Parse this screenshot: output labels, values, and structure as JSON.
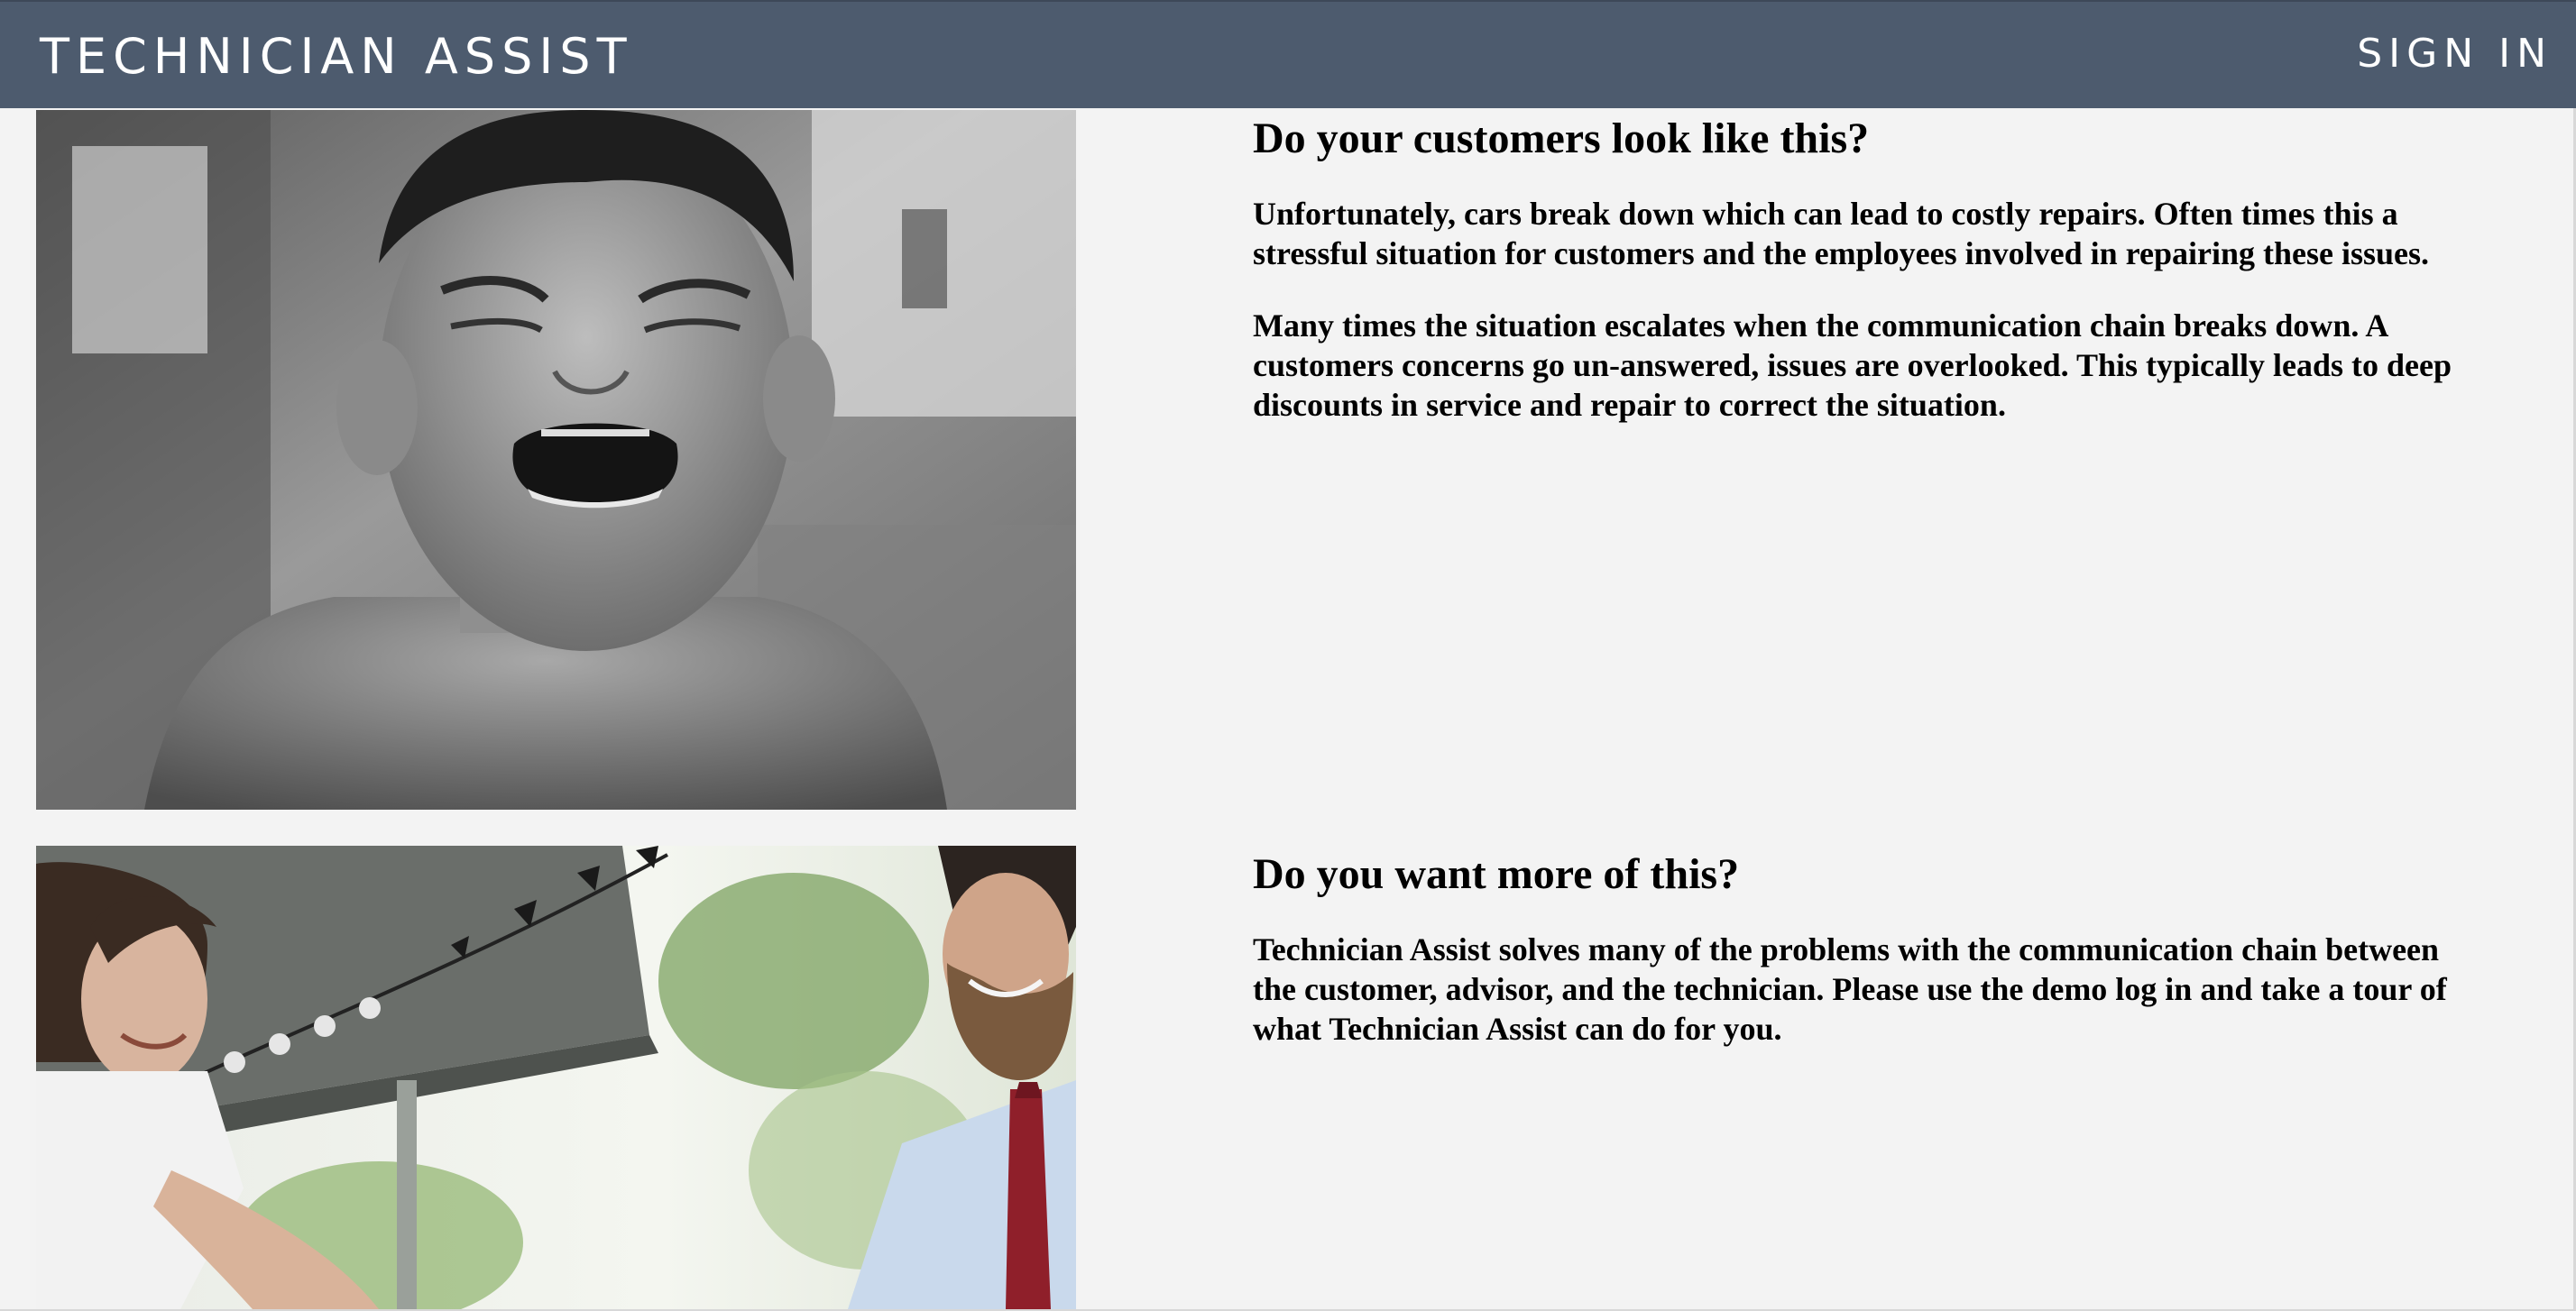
{
  "header": {
    "brand": "TECHNICIAN ASSIST",
    "signin_label": "SIGN IN",
    "background": "#4d5b6e"
  },
  "sections": [
    {
      "heading": "Do your customers look like this?",
      "paragraphs": [
        "Unfortunately, cars break down which can lead to costly repairs. Often times this a stressful situation for customers and the employees involved in repairing these issues.",
        "Many times the situation escalates when the communication chain breaks down. A customers concerns go un-answered, issues are overlooked. This typically leads to deep discounts in service and repair to correct the situation."
      ]
    },
    {
      "heading": "Do you want more of this?",
      "paragraphs": [
        "Technician Assist solves many of the problems with the communication chain between the customer, advisor, and the technician. Please use the demo log in and take a tour of what Technician Assist can do for you."
      ]
    }
  ]
}
